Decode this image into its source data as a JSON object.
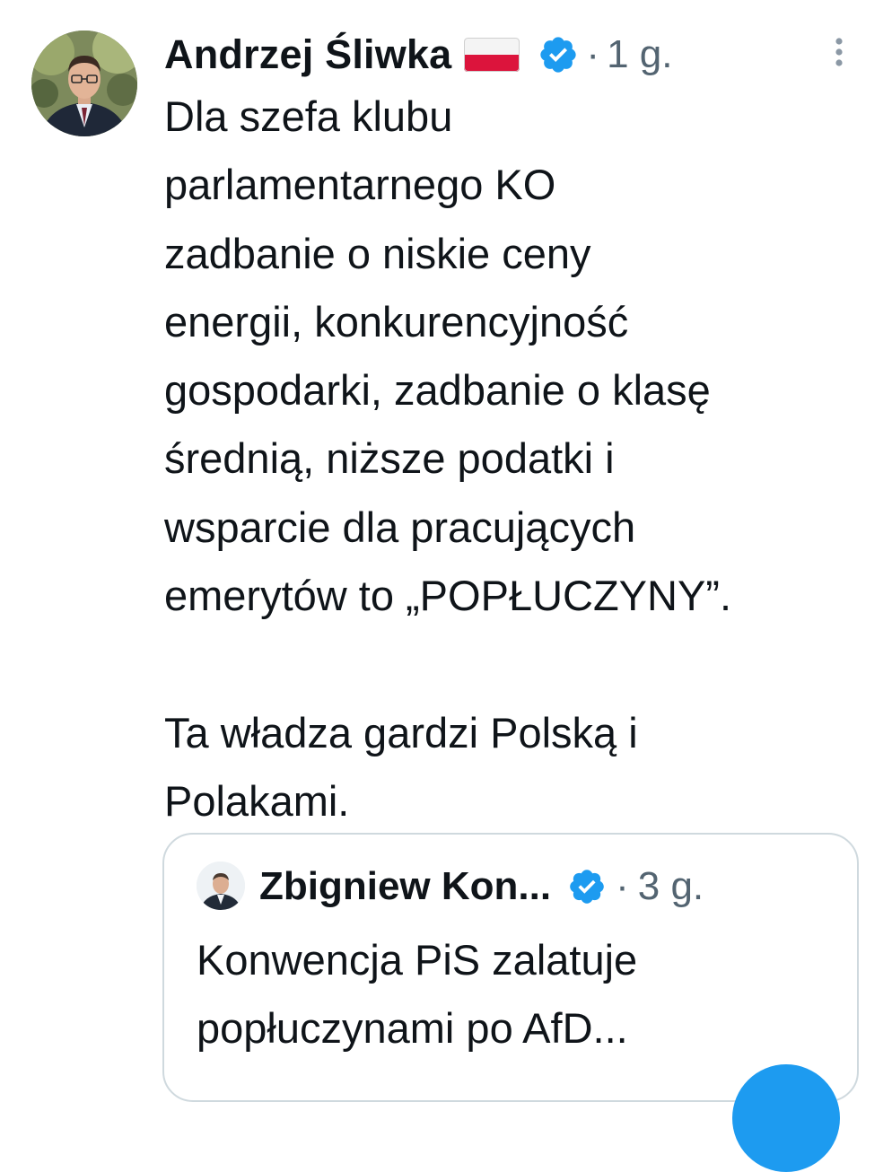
{
  "tweet": {
    "author_name": "Andrzej Śliwka",
    "flag_icon": "poland-flag-icon",
    "verified_icon": "verified-badge-icon",
    "separator": "·",
    "timestamp": "1 g.",
    "more_icon": "more-vertical-icon",
    "text": "Dla szefa klubu\nparlamentarnego KO\nzadbanie o niskie ceny\nenergii, konkurencyjność\ngospodarki, zadbanie o klasę\nśrednią, niższe podatki i\nwsparcie dla pracujących\nemerytów to „POPŁUCZYNY”.\n\nTa władza gardzi Polską i\nPolakami."
  },
  "quoted_tweet": {
    "author_name": "Zbigniew Kon...",
    "verified_icon": "verified-badge-icon",
    "separator": "·",
    "timestamp": "3 g.",
    "text": "Konwencja PiS zalatuje\npopłuczynami po AfD..."
  },
  "colors": {
    "text": "#0f1419",
    "secondary": "#536471",
    "verified": "#1d9bf0",
    "border": "#cfd9de",
    "flag_white": "#ffffff",
    "flag_red": "#dc143c"
  }
}
